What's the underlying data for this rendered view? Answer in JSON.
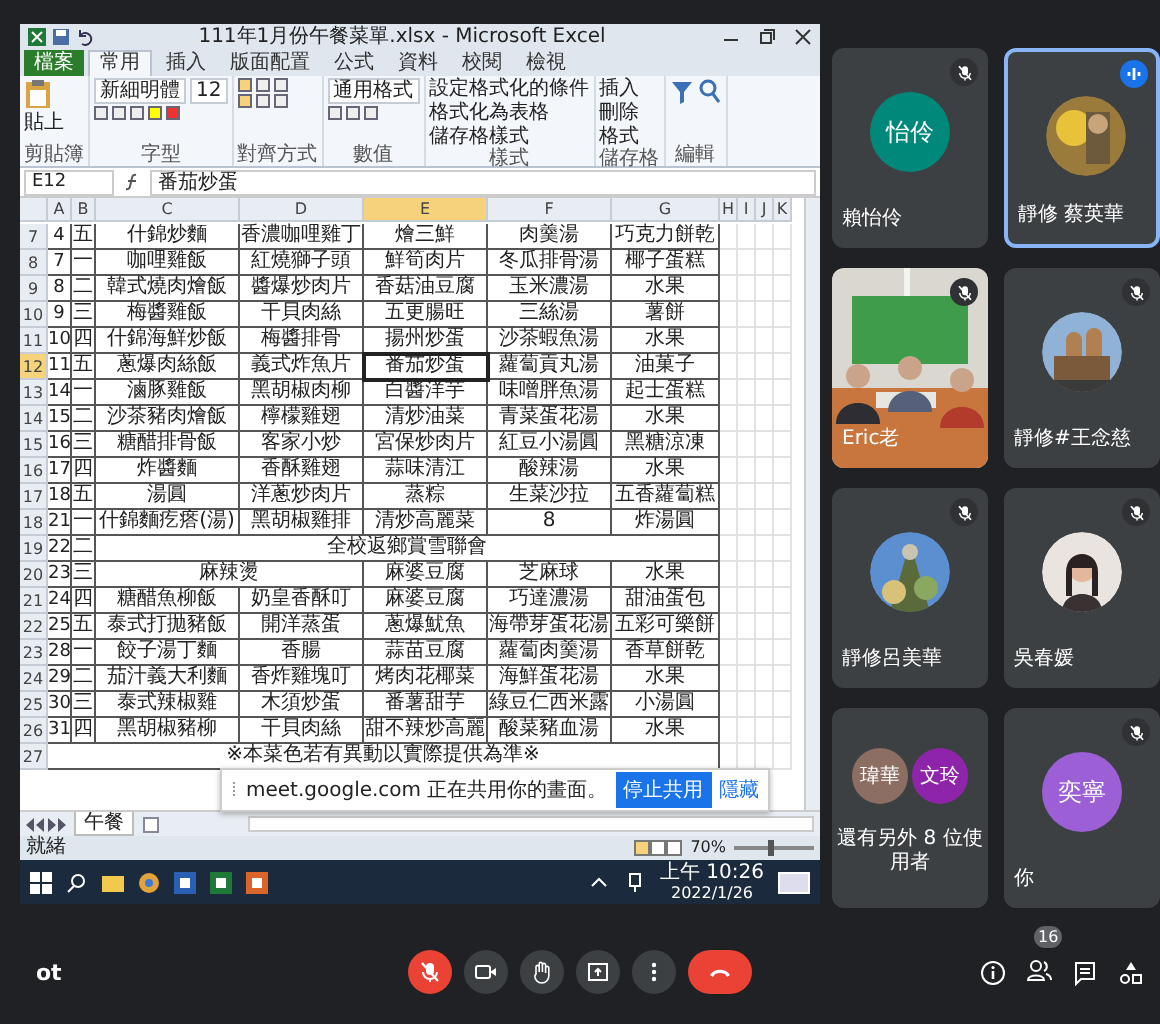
{
  "excel": {
    "title": "111年1月份午餐菜單.xlsx - Microsoft Excel",
    "ribbon_tabs": [
      {
        "label": "檔案",
        "kind": "file",
        "selected": false
      },
      {
        "label": "常用",
        "kind": "tab",
        "selected": true
      },
      {
        "label": "插入",
        "kind": "tab",
        "selected": false
      },
      {
        "label": "版面配置",
        "kind": "tab",
        "selected": false
      },
      {
        "label": "公式",
        "kind": "tab",
        "selected": false
      },
      {
        "label": "資料",
        "kind": "tab",
        "selected": false
      },
      {
        "label": "校閱",
        "kind": "tab",
        "selected": false
      },
      {
        "label": "檢視",
        "kind": "tab",
        "selected": false
      }
    ],
    "ribbon_groups": [
      {
        "kind": "clipboard",
        "label": "剪貼簿",
        "texts": [
          "貼上"
        ]
      },
      {
        "kind": "font",
        "label": "字型",
        "texts": [
          "新細明體",
          "12"
        ]
      },
      {
        "kind": "align",
        "label": "對齊方式"
      },
      {
        "kind": "number",
        "label": "數值",
        "texts": [
          "通用格式"
        ]
      },
      {
        "kind": "list",
        "label": "樣式",
        "texts": [
          "設定格式化的條件",
          "格式化為表格",
          "儲存格樣式"
        ]
      },
      {
        "kind": "list",
        "label": "儲存格",
        "texts": [
          "插入",
          "刪除",
          "格式"
        ]
      },
      {
        "kind": "editing",
        "label": "編輯"
      }
    ],
    "name_box": "E12",
    "formula": "番茄炒蛋",
    "columns": [
      {
        "label": "A",
        "selected": false
      },
      {
        "label": "B",
        "selected": false
      },
      {
        "label": "C",
        "selected": false
      },
      {
        "label": "D",
        "selected": false
      },
      {
        "label": "E",
        "selected": true
      },
      {
        "label": "F",
        "selected": false
      },
      {
        "label": "G",
        "selected": false
      },
      {
        "label": "H",
        "selected": false
      },
      {
        "label": "I",
        "selected": false
      },
      {
        "label": "J",
        "selected": false
      },
      {
        "label": "K",
        "selected": false
      }
    ],
    "rows": [
      {
        "number": "7",
        "kind": "normal",
        "selected": false,
        "cells": [
          "4",
          "五",
          "什錦炒麵",
          "香濃咖哩雞丁",
          "燴三鮮",
          "肉羹湯",
          "巧克力餅乾"
        ]
      },
      {
        "number": "8",
        "kind": "normal",
        "selected": false,
        "cells": [
          "7",
          "一",
          "咖哩雞飯",
          "紅燒獅子頭",
          "鮮筍肉片",
          "冬瓜排骨湯",
          "椰子蛋糕"
        ]
      },
      {
        "number": "9",
        "kind": "normal",
        "selected": false,
        "cells": [
          "8",
          "二",
          "韓式燒肉燴飯",
          "醬爆炒肉片",
          "香菇油豆腐",
          "玉米濃湯",
          "水果"
        ]
      },
      {
        "number": "10",
        "kind": "normal",
        "selected": false,
        "cells": [
          "9",
          "三",
          "梅醬雞飯",
          "干貝肉絲",
          "五更腸旺",
          "三絲湯",
          "薯餅"
        ]
      },
      {
        "number": "11",
        "kind": "normal",
        "selected": false,
        "cells": [
          "10",
          "四",
          "什錦海鮮炒飯",
          "梅醬排骨",
          "揚州炒蛋",
          "沙茶蝦魚湯",
          "水果"
        ]
      },
      {
        "number": "12",
        "kind": "normal",
        "selected": true,
        "cells": [
          "11",
          "五",
          "蔥爆肉絲飯",
          "義式炸魚片",
          "番茄炒蛋",
          "蘿蔔貢丸湯",
          "油菓子"
        ]
      },
      {
        "number": "13",
        "kind": "normal",
        "selected": false,
        "cells": [
          "14",
          "一",
          "滷豚雞飯",
          "黑胡椒肉柳",
          "白醬洋芋",
          "味噌胖魚湯",
          "起士蛋糕"
        ]
      },
      {
        "number": "14",
        "kind": "normal",
        "selected": false,
        "cells": [
          "15",
          "二",
          "沙茶豬肉燴飯",
          "檸檬雞翅",
          "清炒油菜",
          "青菜蛋花湯",
          "水果"
        ]
      },
      {
        "number": "15",
        "kind": "normal",
        "selected": false,
        "cells": [
          "16",
          "三",
          "糖醋排骨飯",
          "客家小炒",
          "宮保炒肉片",
          "紅豆小湯圓",
          "黑糖涼凍"
        ]
      },
      {
        "number": "16",
        "kind": "normal",
        "selected": false,
        "cells": [
          "17",
          "四",
          "炸醬麵",
          "香酥雞翅",
          "蒜味清江",
          "酸辣湯",
          "水果"
        ]
      },
      {
        "number": "17",
        "kind": "normal",
        "selected": false,
        "cells": [
          "18",
          "五",
          "湯圓",
          "洋蔥炒肉片",
          "蒸粽",
          "生菜沙拉",
          "五香蘿蔔糕"
        ]
      },
      {
        "number": "18",
        "kind": "normal",
        "selected": false,
        "cells": [
          "21",
          "一",
          "什錦麵疙瘩(湯)",
          "黑胡椒雞排",
          "清炒高麗菜",
          "8",
          "炸湯圓"
        ]
      },
      {
        "number": "19",
        "kind": "merged",
        "selected": false,
        "cells": [
          "22",
          "二",
          "",
          "",
          "全校返鄉賞雪聯會",
          "",
          ""
        ]
      },
      {
        "number": "20",
        "kind": "partly_merged",
        "selected": false,
        "cells": [
          "23",
          "三",
          "麻辣燙",
          "",
          "麻婆豆腐",
          "芝麻球",
          "水果"
        ]
      },
      {
        "number": "21",
        "kind": "normal",
        "selected": false,
        "cells": [
          "24",
          "四",
          "糖醋魚柳飯",
          "奶皇香酥叮",
          "麻婆豆腐",
          "巧達濃湯",
          "甜油蛋包"
        ]
      },
      {
        "number": "22",
        "kind": "normal",
        "selected": false,
        "cells": [
          "25",
          "五",
          "泰式打拋豬飯",
          "開洋蒸蛋",
          "蔥爆魷魚",
          "海帶芽蛋花湯",
          "五彩可樂餅"
        ]
      },
      {
        "number": "23",
        "kind": "normal",
        "selected": false,
        "cells": [
          "28",
          "一",
          "餃子湯丁麵",
          "香腸",
          "蒜苗豆腐",
          "蘿蔔肉羹湯",
          "香草餅乾"
        ]
      },
      {
        "number": "24",
        "kind": "normal",
        "selected": false,
        "cells": [
          "29",
          "二",
          "茄汁義大利麵",
          "香炸雞塊叮",
          "烤肉花椰菜",
          "海鮮蛋花湯",
          "水果"
        ]
      },
      {
        "number": "25",
        "kind": "normal",
        "selected": false,
        "cells": [
          "30",
          "三",
          "泰式辣椒雞",
          "木須炒蛋",
          "番薯甜芋",
          "綠豆仁西米露",
          "小湯圓"
        ]
      },
      {
        "number": "26",
        "kind": "normal",
        "selected": false,
        "cells": [
          "31",
          "四",
          "黑胡椒豬柳",
          "干貝肉絲",
          "甜不辣炒高麗",
          "酸菜豬血湯",
          "水果"
        ]
      },
      {
        "number": "27",
        "kind": "note",
        "selected": false,
        "cells": [
          "",
          "",
          "",
          "※本菜色若有異動以實際提供為準※",
          "",
          "",
          ""
        ]
      }
    ],
    "sheet_tab": "午餐",
    "status": "就緒",
    "zoom": "70%",
    "zoom_slider": {
      "level": 0.45
    },
    "share_popup": {
      "text": "meet.google.com 正在共用你的畫面。",
      "button": "停止共用",
      "link": "隱藏"
    },
    "taskbar": {
      "time": "上午 10:26",
      "date": "2022/1/26"
    }
  },
  "meet": {
    "tiles": [
      {
        "name": "賴怡伶",
        "kind": "avatar",
        "initials": "怡伶",
        "color": "#00897b",
        "muted": true,
        "speaking": false
      },
      {
        "name": "靜修 蔡英華",
        "muted": false,
        "speaking": true
      },
      {
        "name": "Eric老",
        "kind": "video",
        "muted": true,
        "speaking": false
      },
      {
        "name": "靜修#王念慈",
        "muted": true,
        "speaking": false
      },
      {
        "name": "靜修呂美華",
        "muted": true,
        "speaking": false
      },
      {
        "name": "吳春媛",
        "muted": true,
        "speaking": false
      },
      {
        "name": "還有另外 8 位使用者",
        "kind": "group",
        "muted": false,
        "speaking": false,
        "avatars": [
          {
            "initials": "瑋華",
            "color": "#8d6e63"
          },
          {
            "initials": "文玲",
            "color": "#8e24aa"
          }
        ]
      },
      {
        "name": "你",
        "kind": "avatar",
        "initials": "奕寧",
        "color": "#9c5fd6",
        "muted": true,
        "speaking": false
      }
    ],
    "left_text": "ot",
    "controls": [
      {
        "kind": "mic",
        "muted": true
      },
      {
        "kind": "camera"
      },
      {
        "kind": "hand"
      },
      {
        "kind": "present"
      },
      {
        "kind": "more"
      },
      {
        "kind": "end"
      }
    ],
    "people_count": "16"
  }
}
